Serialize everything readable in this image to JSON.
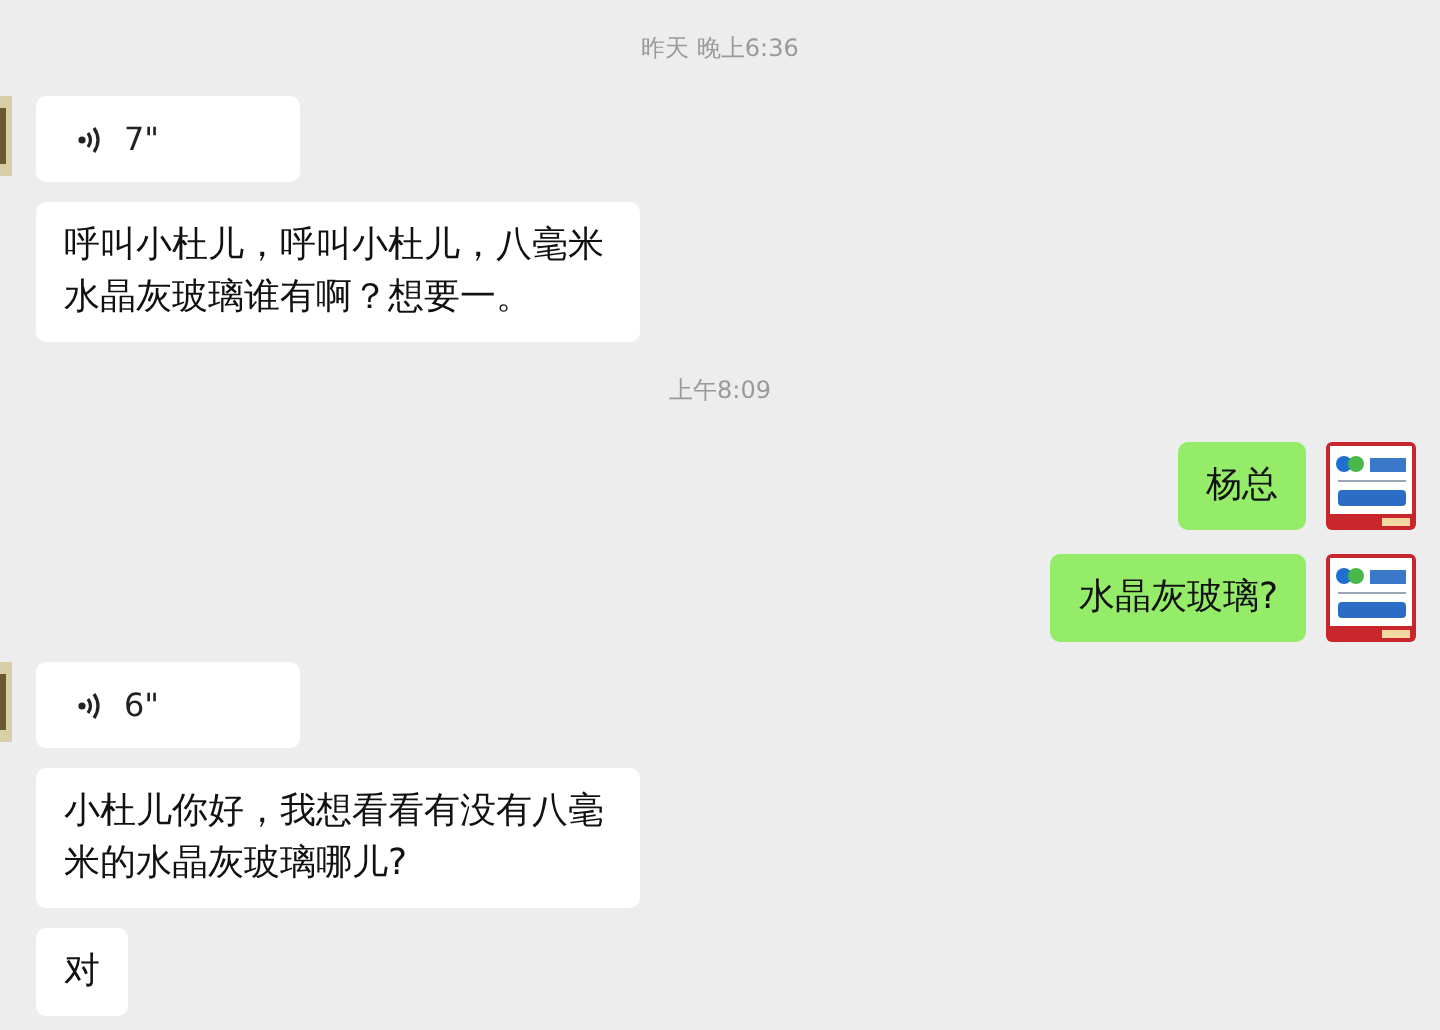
{
  "messages": [
    {
      "kind": "time",
      "text": "昨天 晚上6:36"
    },
    {
      "kind": "voice",
      "outgoing": false,
      "duration": "7\""
    },
    {
      "kind": "text",
      "outgoing": false,
      "text": "呼叫小杜儿，呼叫小杜儿，八毫米水晶灰玻璃谁有啊？想要一。"
    },
    {
      "kind": "time",
      "text": "上午8:09"
    },
    {
      "kind": "text",
      "outgoing": true,
      "text": "杨总"
    },
    {
      "kind": "text",
      "outgoing": true,
      "text": "水晶灰玻璃?"
    },
    {
      "kind": "voice",
      "outgoing": false,
      "duration": "6\""
    },
    {
      "kind": "text",
      "outgoing": false,
      "text": "小杜儿你好，我想看看有没有八毫米的水晶灰玻璃哪儿?"
    },
    {
      "kind": "text",
      "outgoing": false,
      "text": "对"
    }
  ]
}
